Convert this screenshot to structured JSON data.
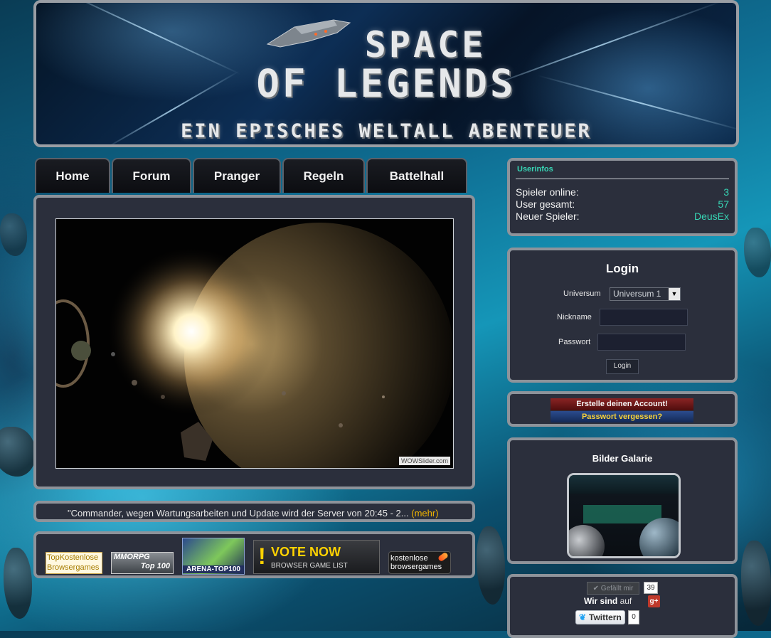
{
  "header": {
    "title_line1": "SPACE",
    "title_line2": "OF LEGENDS",
    "tagline": "EIN EPISCHES WELTALL ABENTEUER"
  },
  "nav": {
    "items": [
      {
        "label": "Home"
      },
      {
        "label": "Forum"
      },
      {
        "label": "Pranger"
      },
      {
        "label": "Regeln"
      },
      {
        "label": "Battelhall"
      }
    ]
  },
  "slider": {
    "watermark": "WOWSlider.com"
  },
  "news": {
    "text": "\"Commander, wegen Wartungsarbeiten und Update wird der Server von 20:45 - 2...",
    "more_link": "(mehr)"
  },
  "ads": {
    "topkostenlose": [
      "TopKostenlose",
      "Browsergames"
    ],
    "mmorpg": [
      "MMORPG",
      "Top 100"
    ],
    "arena": "ARENA-TOP100",
    "vote_now": "VOTE NOW",
    "vote_sub": "BROWSER GAME LIST",
    "kostenlose": [
      "kostenlose",
      "browsergames"
    ]
  },
  "userinfo": {
    "title": "Userinfos",
    "rows": [
      {
        "label": "Spieler online:",
        "value": "3"
      },
      {
        "label": "User gesamt:",
        "value": "57"
      },
      {
        "label": "Neuer Spieler:",
        "value": "DeusEx"
      }
    ]
  },
  "login": {
    "title": "Login",
    "universe_label": "Universum",
    "universe_value": "Universum 1",
    "nickname_label": "Nickname",
    "password_label": "Passwort",
    "button": "Login"
  },
  "account": {
    "create": "Erstelle deinen Account!",
    "forgot": "Passwort vergessen?"
  },
  "gallery": {
    "title": "Bilder Galarie"
  },
  "social": {
    "like_label": "Gefällt mir",
    "like_count": "39",
    "wir_sind": "Wir sind",
    "auf": "auf",
    "gplus": "g+",
    "twitter": "Twittern",
    "twitter_count": "0"
  },
  "colors": {
    "accent_teal": "#37d6b5",
    "panel_bg": "#2b2f3c",
    "panel_border": "#8e939a",
    "news_more": "#f0b400"
  }
}
